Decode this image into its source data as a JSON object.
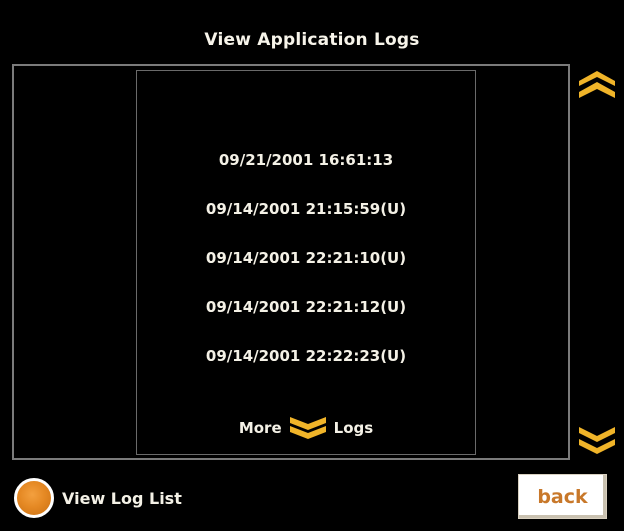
{
  "header": {
    "title": "View Application Logs"
  },
  "logs": {
    "entries": [
      "09/21/2001 16:61:13",
      "09/14/2001 21:15:59(U)",
      "09/14/2001 22:21:10(U)",
      "09/14/2001 22:21:12(U)",
      "09/14/2001 22:22:23(U)"
    ],
    "more_prefix": "More",
    "more_suffix": "Logs"
  },
  "footer": {
    "view_log_list_label": "View Log List",
    "back_label": "back"
  },
  "icons": {
    "scroll_up": "double-chevron-up-icon",
    "scroll_down": "double-chevron-down-icon",
    "more_logs": "double-chevron-down-icon",
    "view_log_list": "radio-button-icon"
  },
  "colors": {
    "background": "#000000",
    "accent": "#f0b429",
    "text": "#f4f1e6",
    "radio": "#e58924",
    "back_text": "#c8782a",
    "frame": "#7b7b7b"
  }
}
